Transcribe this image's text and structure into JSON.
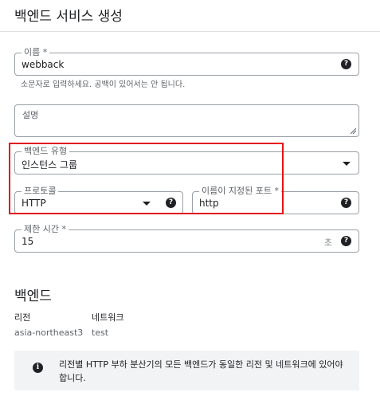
{
  "page_title": "백엔드 서비스 생성",
  "name_field": {
    "label": "이름 *",
    "value": "webback",
    "hint": "소문자로 입력하세요. 공백이 있어서는 안 됩니다."
  },
  "description_field": {
    "label": "설명"
  },
  "backend_type_field": {
    "label": "백엔드 유형",
    "value": "인스턴스 그룹"
  },
  "protocol_field": {
    "label": "프로토콜",
    "value": "HTTP"
  },
  "named_port_field": {
    "label": "이름이 지정된 포트 *",
    "value": "http"
  },
  "timeout_field": {
    "label": "제한 시간 *",
    "value": "15",
    "suffix": "초"
  },
  "backends_section": {
    "title": "백엔드",
    "region_header": "리전",
    "network_header": "네트워크",
    "region_value": "asia-northeast3",
    "network_value": "test"
  },
  "info_message": "리전별 HTTP 부하 분산기의 모든 백엔드가 동일한 리전 및 네트워크에 있어야 합니다.",
  "icons": {
    "help": "?",
    "info": "i"
  },
  "colors": {
    "highlight": "#e11313",
    "info_bg": "#f1f3f4"
  }
}
